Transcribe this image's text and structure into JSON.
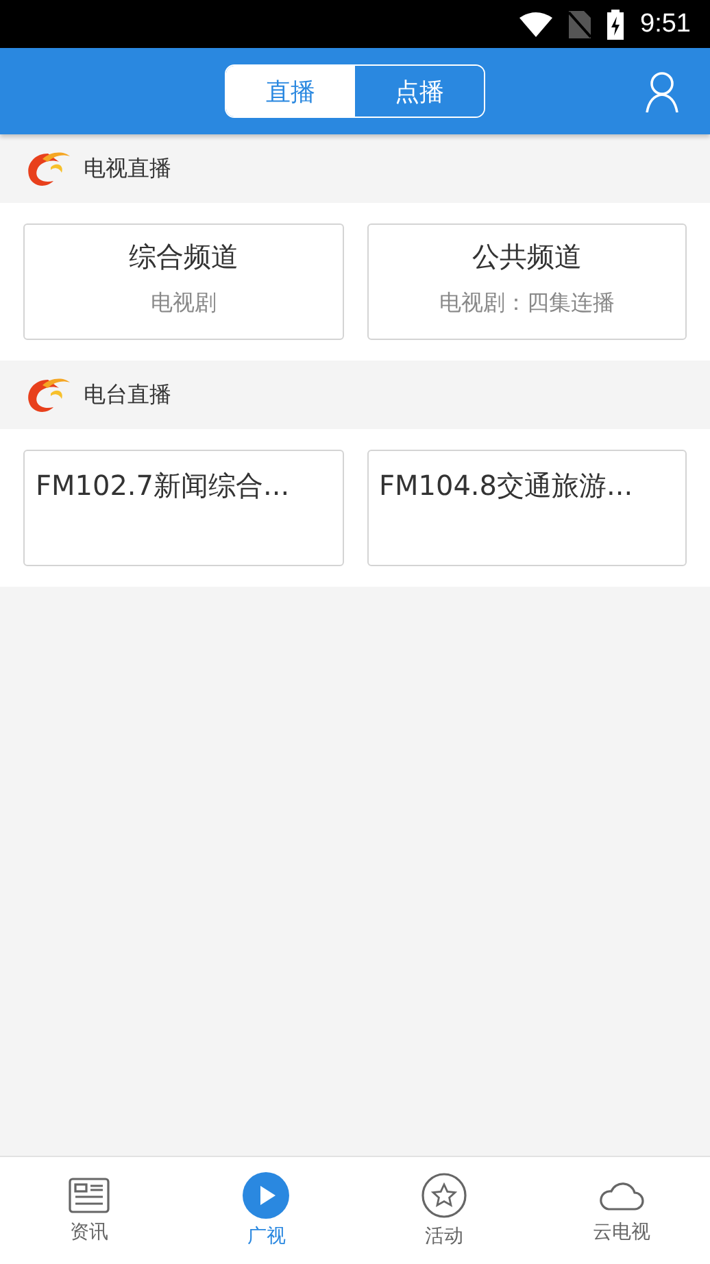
{
  "status_bar": {
    "time": "9:51"
  },
  "header": {
    "segments": [
      {
        "label": "直播",
        "selected": true
      },
      {
        "label": "点播",
        "selected": false
      }
    ]
  },
  "sections": [
    {
      "title": "电视直播",
      "cards": [
        {
          "title": "综合频道",
          "subtitle": "电视剧"
        },
        {
          "title": "公共频道",
          "subtitle": "电视剧：四集连播"
        }
      ]
    },
    {
      "title": "电台直播",
      "cards": [
        {
          "title": "FM102.7新闻综合..."
        },
        {
          "title": "FM104.8交通旅游..."
        }
      ]
    }
  ],
  "bottom_nav": [
    {
      "label": "资讯",
      "selected": false
    },
    {
      "label": "广视",
      "selected": true
    },
    {
      "label": "活动",
      "selected": false
    },
    {
      "label": "云电视",
      "selected": false
    }
  ]
}
